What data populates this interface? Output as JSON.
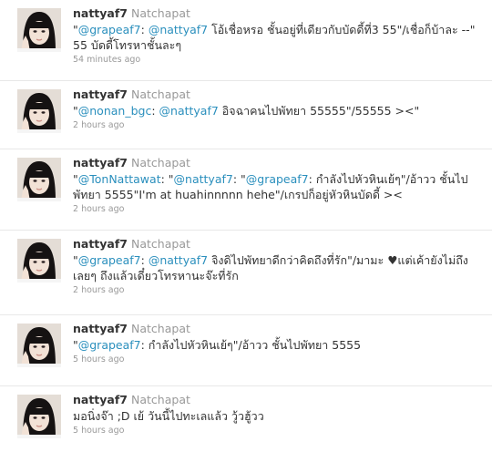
{
  "tweets": [
    {
      "screen_name": "nattyaf7",
      "full_name": "Natchapat",
      "parts": [
        {
          "text": "\"",
          "link": false
        },
        {
          "text": "@grapeaf7",
          "link": true
        },
        {
          "text": ": ",
          "link": false
        },
        {
          "text": "@nattyaf7",
          "link": true
        },
        {
          "text": " โอ้เชื่อหรอ ชั้นอยู่ที่เดียวกับบัดดี้ที่3 55\"/เชื่อก็บ้าละ --\" 55 บัดดี้โทรหาชั้นละๆ",
          "link": false
        }
      ],
      "time": "54 minutes ago"
    },
    {
      "screen_name": "nattyaf7",
      "full_name": "Natchapat",
      "parts": [
        {
          "text": "\"",
          "link": false
        },
        {
          "text": "@nonan_bgc",
          "link": true
        },
        {
          "text": ": ",
          "link": false
        },
        {
          "text": "@nattyaf7",
          "link": true
        },
        {
          "text": " อิจฉาคนไปพัทยา 55555\"/55555 ><\"",
          "link": false
        }
      ],
      "time": "2 hours ago"
    },
    {
      "screen_name": "nattyaf7",
      "full_name": "Natchapat",
      "parts": [
        {
          "text": "\"",
          "link": false
        },
        {
          "text": "@TonNattawat",
          "link": true
        },
        {
          "text": ": \"",
          "link": false
        },
        {
          "text": "@nattyaf7",
          "link": true
        },
        {
          "text": ": \"",
          "link": false
        },
        {
          "text": "@grapeaf7",
          "link": true
        },
        {
          "text": ": กำลังไปหัวหินเย้ๆ\"/อ้าวว ชั้นไปพัทยา 5555\"I'm at huahinnnnn hehe\"/เกรปก็อยู่หัวหินบัดดี้ ><",
          "link": false
        }
      ],
      "time": "2 hours ago"
    },
    {
      "screen_name": "nattyaf7",
      "full_name": "Natchapat",
      "parts": [
        {
          "text": "\"",
          "link": false
        },
        {
          "text": "@grapeaf7",
          "link": true
        },
        {
          "text": ": ",
          "link": false
        },
        {
          "text": "@nattyaf7",
          "link": true
        },
        {
          "text": " จิงดิไปพัทยาดีกว่าคิดถึงที่รัก\"/มามะ ♥แต่เค้ายังไม่ถึงเลยๆ ถึงแล้วเดี๋ยวโทรหานะจ๊ะที่รัก",
          "link": false
        }
      ],
      "time": "2 hours ago"
    },
    {
      "screen_name": "nattyaf7",
      "full_name": "Natchapat",
      "parts": [
        {
          "text": "\"",
          "link": false
        },
        {
          "text": "@grapeaf7",
          "link": true
        },
        {
          "text": ": กำลังไปหัวหินเย้ๆ\"/อ้าวว ชั้นไปพัทยา 5555",
          "link": false
        }
      ],
      "time": "5 hours ago"
    },
    {
      "screen_name": "nattyaf7",
      "full_name": "Natchapat",
      "parts": [
        {
          "text": "มอนิ่งจ๊า ;D เย้ วันนี้ไปทะเลแล้ว วู้วฮู้วว",
          "link": false
        }
      ],
      "time": "5 hours ago"
    }
  ],
  "colors": {
    "link": "#2a8fbd",
    "text": "#333333",
    "muted": "#999999",
    "divider": "#e8e8e8"
  }
}
